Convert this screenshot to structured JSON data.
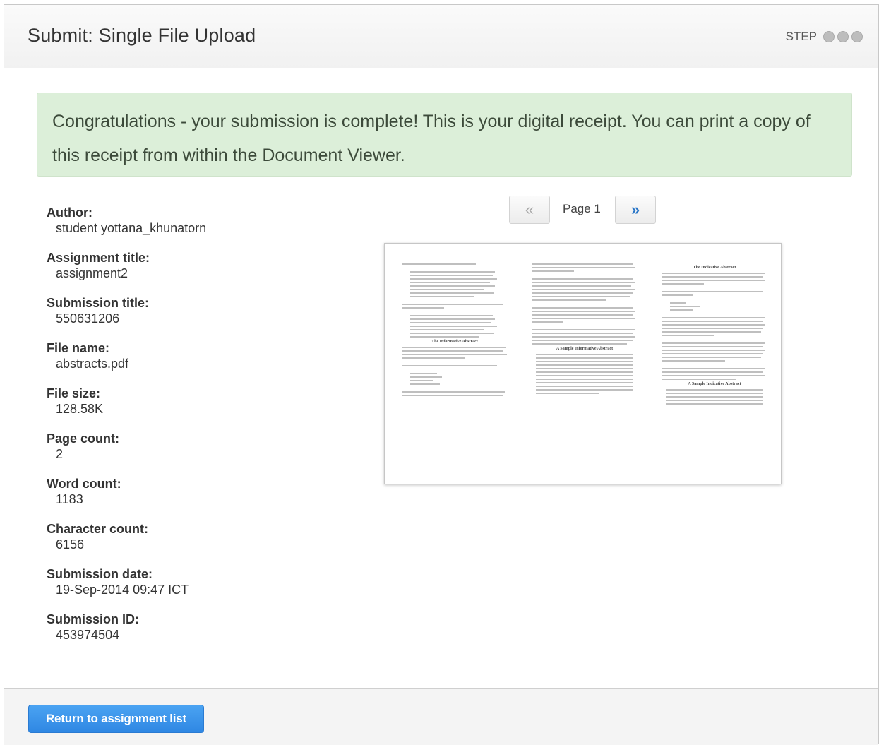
{
  "header": {
    "title": "Submit: Single File Upload",
    "step_label": "STEP"
  },
  "alert": {
    "message": "Congratulations - your submission is complete! This is your digital receipt. You can print a copy of this receipt from within the Document Viewer."
  },
  "receipt": [
    {
      "label": "Author:",
      "value": "student yottana_khunatorn"
    },
    {
      "label": "Assignment title:",
      "value": "assignment2"
    },
    {
      "label": "Submission title:",
      "value": "550631206"
    },
    {
      "label": "File name:",
      "value": "abstracts.pdf"
    },
    {
      "label": "File size:",
      "value": "128.58K"
    },
    {
      "label": "Page count:",
      "value": "2"
    },
    {
      "label": "Word count:",
      "value": "1183"
    },
    {
      "label": "Character count:",
      "value": "6156"
    },
    {
      "label": "Submission date:",
      "value": "19-Sep-2014 09:47 ICT"
    },
    {
      "label": "Submission ID:",
      "value": "453974504"
    }
  ],
  "pager": {
    "prev_icon": "«",
    "next_icon": "»",
    "page_label": "Page 1"
  },
  "preview": {
    "headings": [
      "The Informative Abstract",
      "A Sample Informative Abstract",
      "The Indicative Abstract",
      "A Sample Indicative Abstract"
    ]
  },
  "footer": {
    "return_label": "Return to assignment list"
  },
  "colors": {
    "alert_bg": "#dcefd9",
    "primary_button": "#3a93ea",
    "next_arrow": "#2a76c7"
  }
}
